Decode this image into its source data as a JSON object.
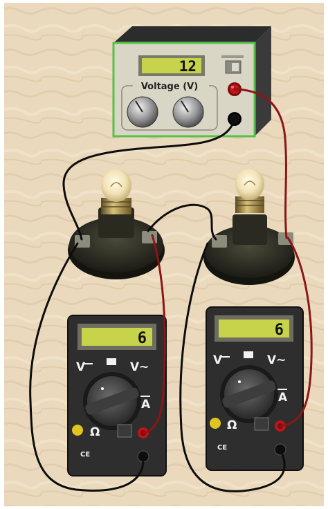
{
  "power_supply": {
    "display": "12",
    "voltage_label": "Voltage (V)",
    "panel_color": "#d9d6c5",
    "frame_color": "#55c14b",
    "lcd_color": "#c7d34a",
    "red_terminal_color": "#c0141c",
    "black_terminal_color": "#111111"
  },
  "bulbs": [
    {
      "name": "bulb-left",
      "state": "lit"
    },
    {
      "name": "bulb-right",
      "state": "lit"
    }
  ],
  "multimeters": [
    {
      "display": "6",
      "labels": {
        "dc_volts": "V",
        "ac_volts": "V~",
        "ohms": "Ω",
        "amps": "A",
        "ce": "CE"
      }
    },
    {
      "display": "6",
      "labels": {
        "dc_volts": "V",
        "ac_volts": "V~",
        "ohms": "Ω",
        "amps": "A",
        "ce": "CE"
      }
    }
  ],
  "wires": {
    "red": "#8b1616",
    "black": "#0d0d0d"
  },
  "background_color": "#ead9bd"
}
